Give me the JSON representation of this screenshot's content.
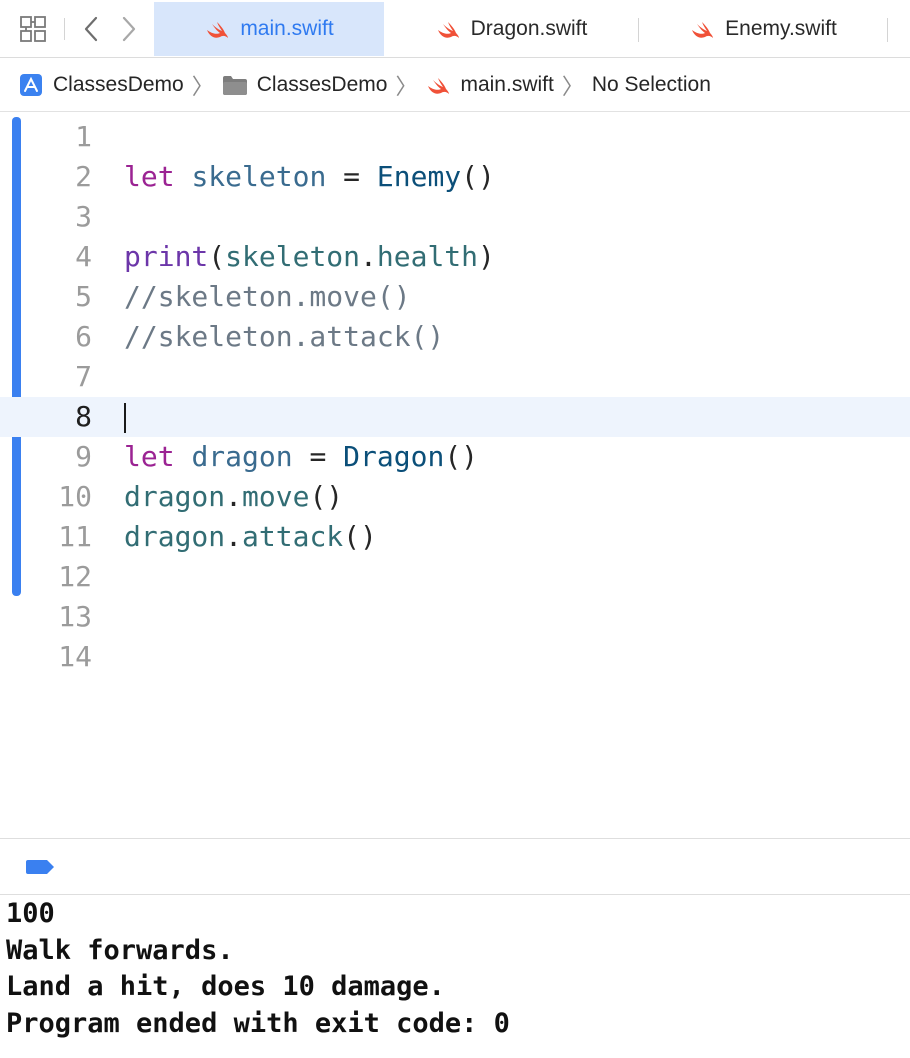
{
  "tabs": [
    {
      "label": "main.swift",
      "active": true
    },
    {
      "label": "Dragon.swift",
      "active": false
    },
    {
      "label": "Enemy.swift",
      "active": false
    }
  ],
  "breadcrumb": {
    "project": "ClassesDemo",
    "folder": "ClassesDemo",
    "file": "main.swift",
    "symbol": "No Selection"
  },
  "editor": {
    "current_line": 8,
    "line_numbers": [
      "1",
      "2",
      "3",
      "4",
      "5",
      "6",
      "7",
      "8",
      "9",
      "10",
      "11",
      "12",
      "13",
      "14"
    ],
    "code": {
      "l2": {
        "kw": "let",
        "var": "skeleton",
        "op": " = ",
        "type": "Enemy",
        "paren": "()"
      },
      "l4": {
        "fn": "print",
        "open": "(",
        "obj": "skeleton",
        "dot": ".",
        "prop": "health",
        "close": ")"
      },
      "l5": "//skeleton.move()",
      "l6": "//skeleton.attack()",
      "l9": {
        "kw": "let",
        "var": "dragon",
        "op": " = ",
        "type": "Dragon",
        "paren": "()"
      },
      "l10": {
        "obj": "dragon",
        "dot": ".",
        "method": "move",
        "paren": "()"
      },
      "l11": {
        "obj": "dragon",
        "dot": ".",
        "method": "attack",
        "paren": "()"
      }
    }
  },
  "console": {
    "lines": [
      "100",
      "Walk forwards.",
      "Land a hit, does 10 damage.",
      "Program ended with exit code: 0"
    ]
  },
  "colors": {
    "accent": "#2f7af0",
    "keyword": "#9b2393",
    "function": "#6c36a9",
    "type": "#0b4f79",
    "comment": "#6c7986",
    "swift_orange": "#f05138"
  },
  "icons": {
    "grid": "related-items-grid-icon",
    "back": "chevron-left-icon",
    "forward": "chevron-right-icon",
    "swift": "swift-logo-icon",
    "project": "xcode-project-icon",
    "folder": "folder-icon",
    "debug": "debug-area-pill-icon"
  }
}
